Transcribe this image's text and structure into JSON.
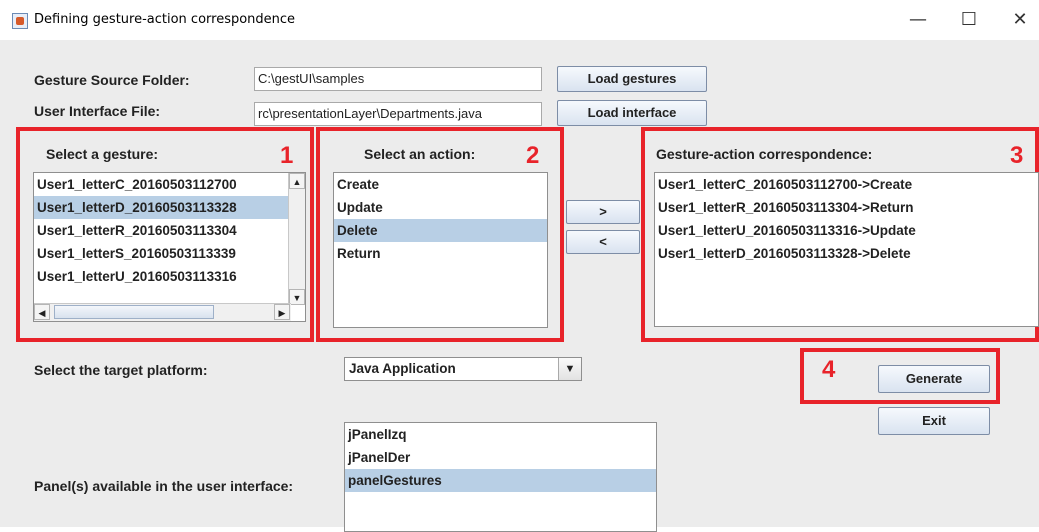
{
  "window": {
    "title": "Defining gesture-action correspondence",
    "minimize": "—",
    "maximize": "☐",
    "close": "✕"
  },
  "source": {
    "label": "Gesture Source Folder:",
    "value": "C:\\gestUI\\samples",
    "button": "Load gestures"
  },
  "ui_file": {
    "label": "User Interface File:",
    "value": "rc\\presentationLayer\\Departments.java",
    "button": "Load interface"
  },
  "gestures": {
    "title": "Select a gesture:",
    "items": [
      "User1_letterC_20160503112700",
      "User1_letterD_20160503113328",
      "User1_letterR_20160503113304",
      "User1_letterS_20160503113339",
      "User1_letterU_20160503113316"
    ],
    "selected_index": 1
  },
  "actions": {
    "title": "Select an action:",
    "items": [
      "Create",
      "Update",
      "Delete",
      "Return"
    ],
    "selected_index": 2
  },
  "transfer": {
    "add": ">",
    "remove": "<"
  },
  "correspondence": {
    "title": "Gesture-action correspondence:",
    "items": [
      "User1_letterC_20160503112700->Create",
      "User1_letterR_20160503113304->Return",
      "User1_letterU_20160503113316->Update",
      "User1_letterD_20160503113328->Delete"
    ]
  },
  "callouts": [
    "1",
    "2",
    "3",
    "4"
  ],
  "platform": {
    "label": "Select the target platform:",
    "selected": "Java Application"
  },
  "panels": {
    "label": "Panel(s) available in the user interface:",
    "items": [
      "jPanelIzq",
      "jPanelDer",
      "panelGestures"
    ],
    "selected_index": 2
  },
  "buttons": {
    "generate": "Generate",
    "exit": "Exit"
  },
  "colors": {
    "callout_red": "#e8232a",
    "selection": "#b8cfe5"
  }
}
